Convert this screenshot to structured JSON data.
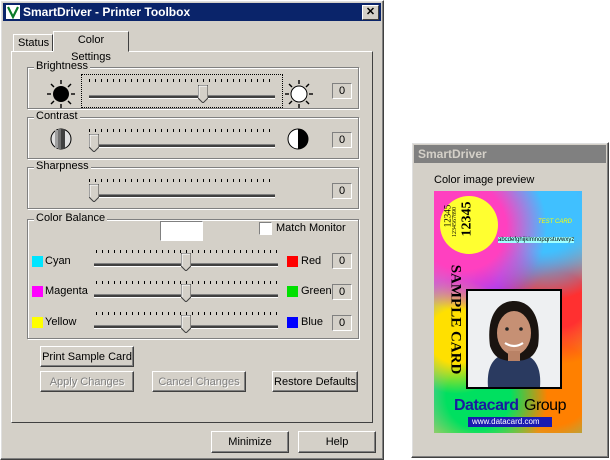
{
  "main_window": {
    "title": "SmartDriver - Printer Toolbox",
    "close_label": "✕",
    "tabs": [
      {
        "label": "Status"
      },
      {
        "label": "Color Settings"
      }
    ],
    "brightness": {
      "label": "Brightness",
      "value": "0",
      "level": 0.62
    },
    "contrast": {
      "label": "Contrast",
      "value": "0",
      "level": 0.0
    },
    "sharpness": {
      "label": "Sharpness",
      "value": "0",
      "level": 0.0
    },
    "color_balance": {
      "label": "Color Balance",
      "match_monitor_label": "Match Monitor",
      "rows": [
        {
          "left": "Cyan",
          "left_color": "#00e5ff",
          "right": "Red",
          "right_color": "#ff0000",
          "value": "0",
          "level": 0.5
        },
        {
          "left": "Magenta",
          "left_color": "#ff00ff",
          "right": "Green",
          "right_color": "#00e000",
          "value": "0",
          "level": 0.5
        },
        {
          "left": "Yellow",
          "left_color": "#ffff00",
          "right": "Blue",
          "right_color": "#0000ff",
          "value": "0",
          "level": 0.5
        }
      ]
    },
    "buttons": {
      "print_sample": "Print Sample Card",
      "apply": "Apply Changes",
      "cancel": "Cancel Changes",
      "restore": "Restore Defaults",
      "minimize": "Minimize",
      "help": "Help"
    }
  },
  "preview_window": {
    "title": "SmartDriver",
    "caption": "Color image preview",
    "card": {
      "numbers_small": "12345",
      "numbers_small2": "1234567890",
      "numbers_big": "12345",
      "test_card": "TEST CARD",
      "strip_text": "abcdefghijklmnopqrstuvwxyz",
      "sample_card": "SAMPLE CARD",
      "brand_a": "Datacard",
      "brand_b": "Group",
      "url": "www.datacard.com"
    }
  }
}
